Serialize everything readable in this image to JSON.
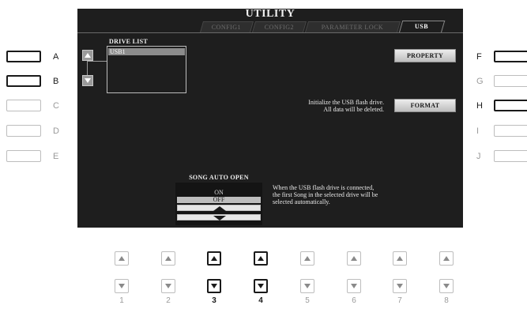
{
  "screen": {
    "title": "UTILITY",
    "tabs": [
      {
        "label": "CONFIG1",
        "active": false
      },
      {
        "label": "CONFIG2",
        "active": false
      },
      {
        "label": "PARAMETER LOCK",
        "active": false
      },
      {
        "label": "USB",
        "active": true
      }
    ],
    "drive_list": {
      "title": "DRIVE LIST",
      "items": [
        "USB1"
      ],
      "selected": "USB1"
    },
    "property_button": "PROPERTY",
    "format_message_line1": "Initialize the USB flash drive.",
    "format_message_line2": "All data will be deleted.",
    "format_button": "FORMAT",
    "song_auto_open": {
      "title": "SONG AUTO OPEN",
      "options": [
        "ON",
        "OFF"
      ],
      "selected": "OFF",
      "description_line1": "When the USB flash drive is connected,",
      "description_line2": "the first Song in the selected drive will be",
      "description_line3": "selected automatically."
    }
  },
  "left_buttons": [
    {
      "label": "A",
      "active": true
    },
    {
      "label": "B",
      "active": true
    },
    {
      "label": "C",
      "active": false
    },
    {
      "label": "D",
      "active": false
    },
    {
      "label": "E",
      "active": false
    }
  ],
  "right_buttons": [
    {
      "label": "F",
      "active": true
    },
    {
      "label": "G",
      "active": false
    },
    {
      "label": "H",
      "active": true
    },
    {
      "label": "I",
      "active": false
    },
    {
      "label": "J",
      "active": false
    }
  ],
  "bottom_columns": [
    {
      "number": "1",
      "active": false
    },
    {
      "number": "2",
      "active": false
    },
    {
      "number": "3",
      "active": true
    },
    {
      "number": "4",
      "active": true
    },
    {
      "number": "5",
      "active": false
    },
    {
      "number": "6",
      "active": false
    },
    {
      "number": "7",
      "active": false
    },
    {
      "number": "8",
      "active": false
    }
  ],
  "icons": [
    "up-arrow-icon",
    "down-arrow-icon",
    "double-up-arrow-icon",
    "double-down-arrow-icon"
  ],
  "colors": {
    "screen_bg": "#1e1e1e",
    "selection": "#8c8c8c",
    "active_border": "#1a1a1a",
    "inactive_border": "#bdbdbd"
  }
}
